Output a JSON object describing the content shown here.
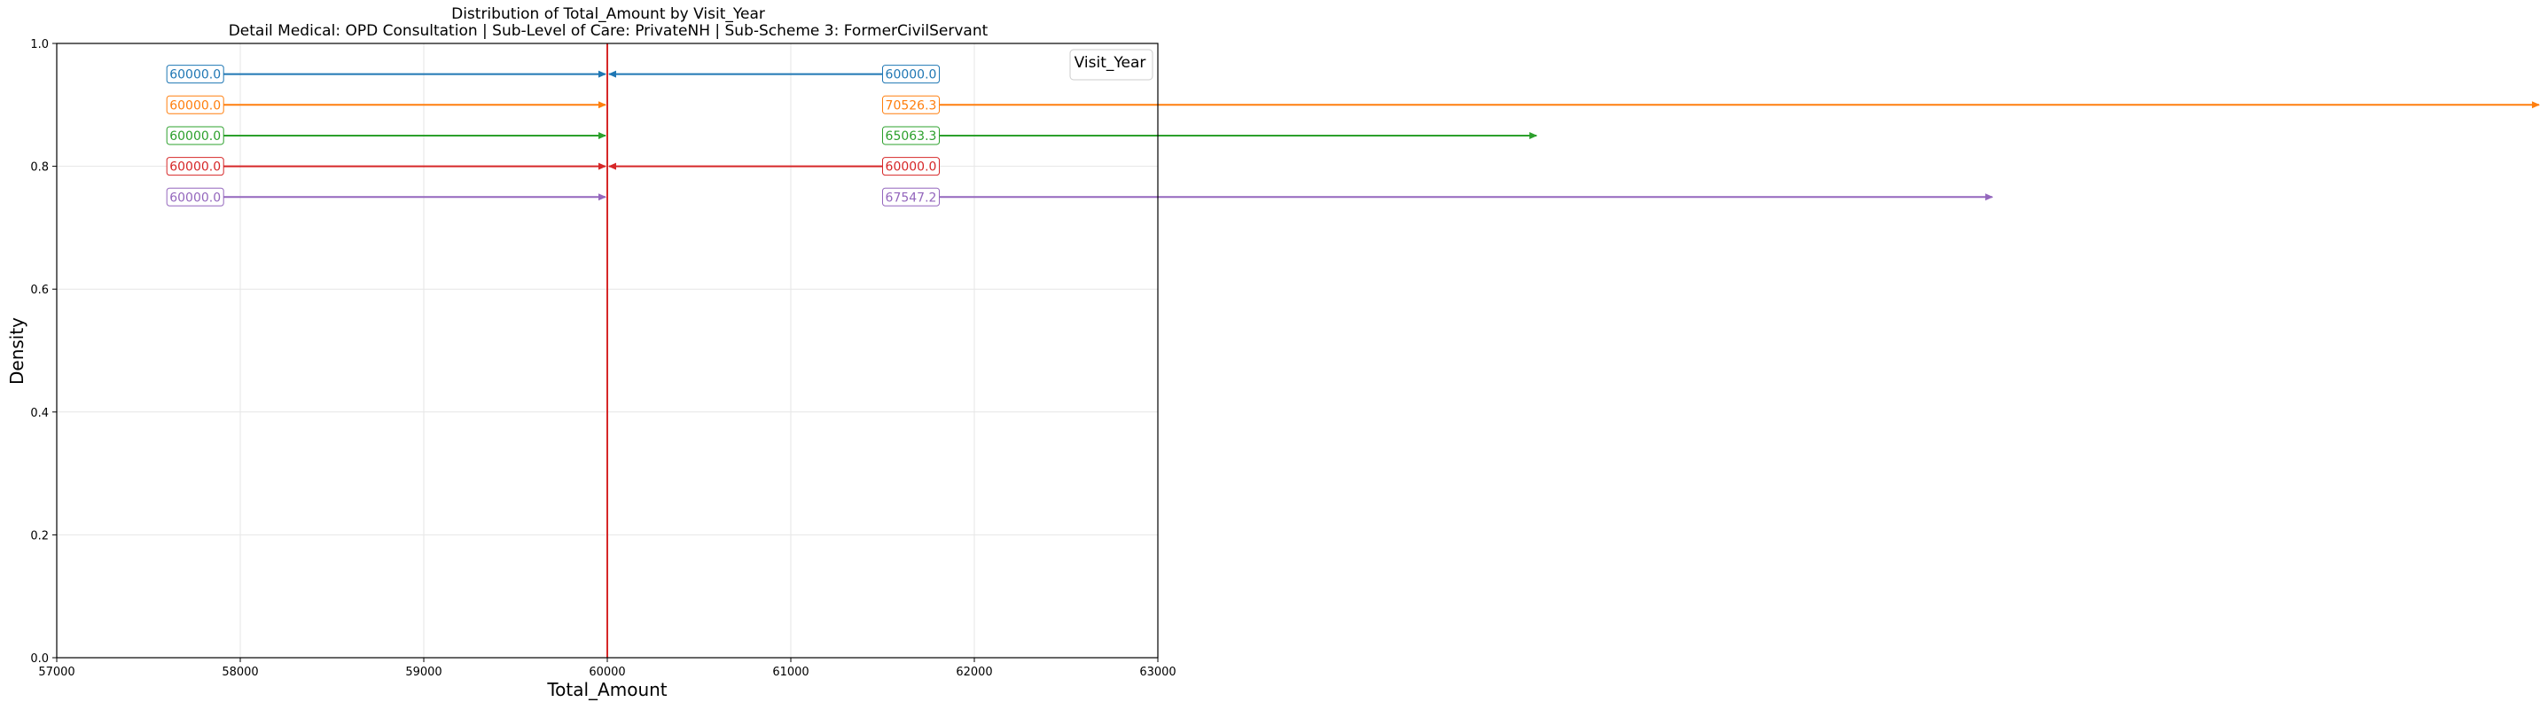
{
  "chart_data": {
    "type": "line",
    "title": "Distribution of Total_Amount by Visit_Year",
    "subtitle": "Detail Medical: OPD Consultation | Sub-Level of Care: PrivateNH | Sub-Scheme 3: FormerCivilServant",
    "xlabel": "Total_Amount",
    "ylabel": "Density",
    "xlim": [
      57000,
      63000
    ],
    "ylim": [
      0.0,
      1.0
    ],
    "xticks": [
      "57000",
      "58000",
      "59000",
      "60000",
      "61000",
      "62000",
      "63000"
    ],
    "yticks": [
      "0.0",
      "0.2",
      "0.4",
      "0.6",
      "0.8",
      "1.0"
    ],
    "grid": true,
    "legend": {
      "title": "Visit_Year",
      "placement": "top-right"
    },
    "vertical_lines": [
      {
        "x": 60000,
        "color": "#1f77b4"
      },
      {
        "x": 60000,
        "color": "#d62728"
      }
    ],
    "annotations": [
      {
        "y": 0.95,
        "color": "#1f77b4",
        "left_label": "60000.0",
        "left_target": 60000,
        "right_label": "60000.0",
        "right_target": 60000
      },
      {
        "y": 0.9,
        "color": "#ff7f0e",
        "left_label": "60000.0",
        "left_target": 60000,
        "right_label": "70526.3",
        "right_target": 70526.3
      },
      {
        "y": 0.85,
        "color": "#2ca02c",
        "left_label": "60000.0",
        "left_target": 60000,
        "right_label": "65063.3",
        "right_target": 65063.3
      },
      {
        "y": 0.8,
        "color": "#d62728",
        "left_label": "60000.0",
        "left_target": 60000,
        "right_label": "60000.0",
        "right_target": 60000
      },
      {
        "y": 0.75,
        "color": "#9467bd",
        "left_label": "60000.0",
        "left_target": 60000,
        "right_label": "67547.2",
        "right_target": 67547.2
      }
    ]
  }
}
